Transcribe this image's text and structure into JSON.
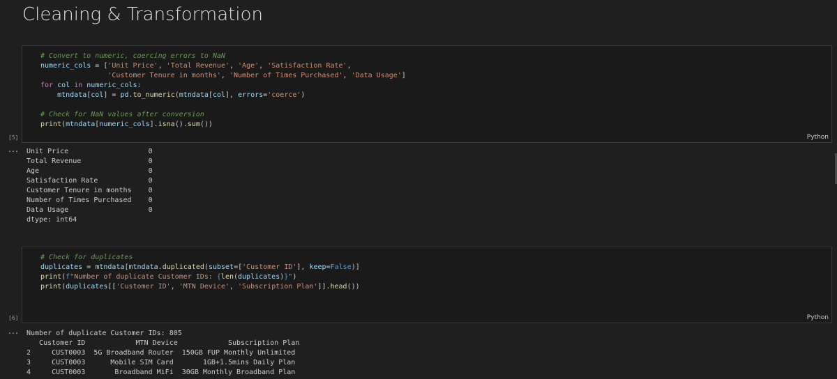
{
  "heading": "Cleaning & Transformation",
  "cells": [
    {
      "exec_count": "[5]",
      "language": "Python",
      "code_lines": [
        "# Convert to numeric, coercing errors to NaN",
        "numeric_cols = ['Unit Price', 'Total Revenue', 'Age', 'Satisfaction Rate',",
        "                'Customer Tenure in months', 'Number of Times Purchased', 'Data Usage']",
        "for col in numeric_cols:",
        "    mtndata[col] = pd.to_numeric(mtndata[col], errors='coerce')",
        "",
        "# Check for NaN values after conversion",
        "print(mtndata[numeric_cols].isna().sum())"
      ],
      "output_lines": [
        "Unit Price                   0",
        "Total Revenue                0",
        "Age                          0",
        "Satisfaction Rate            0",
        "Customer Tenure in months    0",
        "Number of Times Purchased    0",
        "Data Usage                   0",
        "dtype: int64"
      ]
    },
    {
      "exec_count": "[6]",
      "language": "Python",
      "code_lines": [
        "# Check for duplicates",
        "duplicates = mtndata[mtndata.duplicated(subset=['Customer ID'], keep=False)]",
        "print(f\"Number of duplicate Customer IDs: {len(duplicates)}\")",
        "print(duplicates[['Customer ID', 'MTN Device', 'Subscription Plan']].head())"
      ],
      "output_lines": [
        "Number of duplicate Customer IDs: 805",
        "   Customer ID            MTN Device            Subscription Plan",
        "2     CUST0003  5G Broadband Router  150GB FUP Monthly Unlimited",
        "3     CUST0003      Mobile SIM Card       1GB+1.5mins Daily Plan",
        "4     CUST0003       Broadband MiFi  30GB Monthly Broadband Plan"
      ]
    }
  ],
  "output_marker": "...",
  "colors": {
    "background": "#1f1f1f",
    "comment": "#6a9955",
    "string": "#ce9178",
    "variable": "#9cdcfe",
    "function": "#dcdcaa"
  }
}
